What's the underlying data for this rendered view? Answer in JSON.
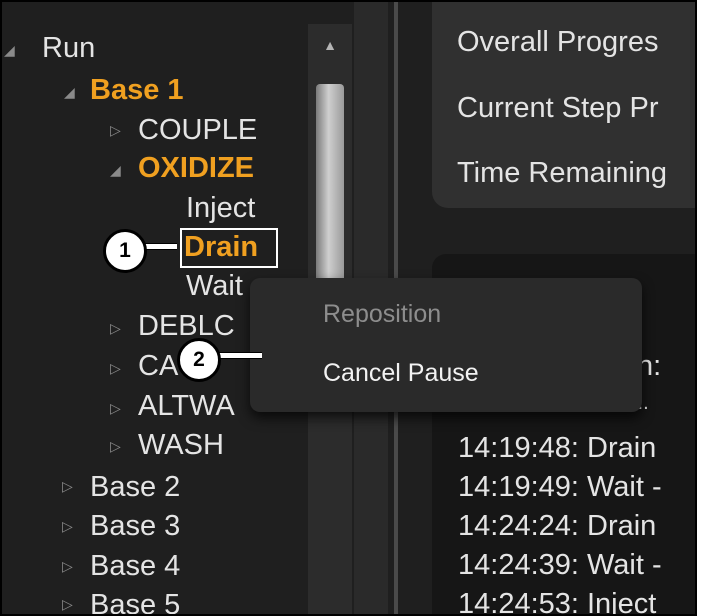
{
  "tree": {
    "run": "Run",
    "base1": "Base 1",
    "couple": "COUPLE",
    "oxidize": "OXIDIZE",
    "inject": "Inject",
    "drain": "Drain",
    "wait": "Wait",
    "deblock": "DEBLC",
    "cap": "CA",
    "altwash": "ALTWA",
    "wash": "WASH",
    "base2": "Base 2",
    "base3": "Base 3",
    "base4": "Base 4",
    "base5": "Base 5"
  },
  "progress": {
    "overall": "Overall Progres",
    "current_step": "Current Step Pr",
    "time_remaining": "Time Remaining"
  },
  "log": {
    "partial1": "n:",
    "partial2": "...",
    "lines": [
      "14:19:48: Drain",
      "14:19:49: Wait -",
      "14:24:24: Drain",
      "14:24:39: Wait -",
      "14:24:53: Inject"
    ]
  },
  "context_menu": {
    "reposition": "Reposition",
    "cancel_pause": "Cancel Pause"
  },
  "callouts": {
    "one": "1",
    "two": "2"
  },
  "colors": {
    "active": "#f0a020",
    "background": "#1f1f1f"
  }
}
